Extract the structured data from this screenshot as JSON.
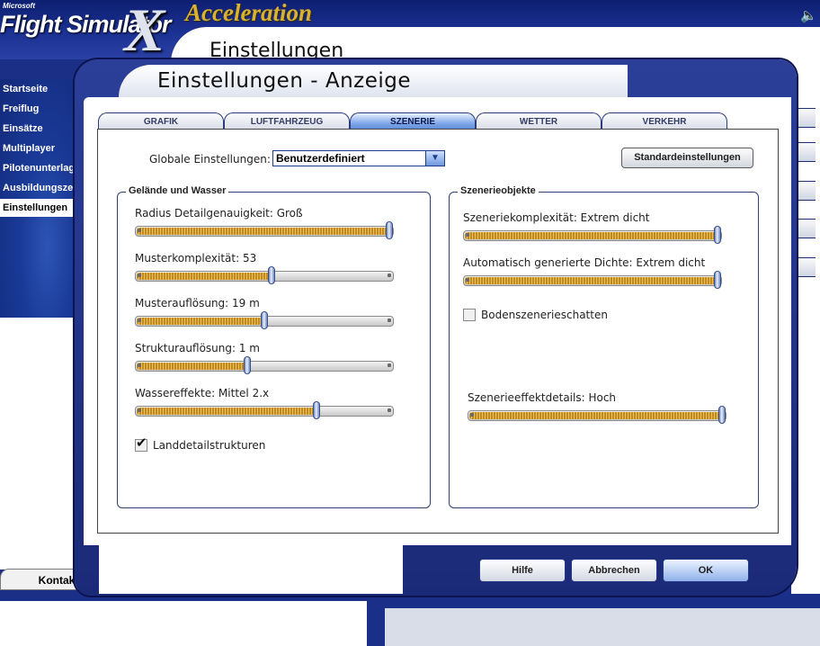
{
  "app": {
    "logo_microsoft": "Microsoft",
    "logo_product": "Flight Simulator",
    "logo_x": "X",
    "logo_edition": "Acceleration",
    "page_title": "Einstellungen"
  },
  "sidebar": {
    "items": [
      {
        "label": "Startseite"
      },
      {
        "label": "Freiflug"
      },
      {
        "label": "Einsätze"
      },
      {
        "label": "Multiplayer"
      },
      {
        "label": "Pilotenunterlagen"
      },
      {
        "label": "Ausbildungszentrum"
      },
      {
        "label": "Einstellungen",
        "active": true
      }
    ]
  },
  "bottom": {
    "kontakte_tab": "Kontakte"
  },
  "dialog": {
    "title": "Einstellungen - Anzeige",
    "tabs": [
      {
        "label": "GRAFIK"
      },
      {
        "label": "LUFTFAHRZEUG"
      },
      {
        "label": "SZENERIE",
        "active": true
      },
      {
        "label": "WETTER"
      },
      {
        "label": "VERKEHR"
      }
    ],
    "global_label": "Globale Einstellungen:",
    "global_value": "Benutzerdefiniert",
    "defaults_button": "Standardeinstellungen",
    "terrain": {
      "title": "Gelände und Wasser",
      "sliders": [
        {
          "label": "Radius Detailgenauigkeit: Groß",
          "value": 1.0
        },
        {
          "label": "Musterkomplexität: 53",
          "value": 0.53
        },
        {
          "label": "Musterauflösung: 19 m",
          "value": 0.5
        },
        {
          "label": "Strukturauflösung: 1 m",
          "value": 0.43
        },
        {
          "label": "Wassereffekte: Mittel 2.x",
          "value": 0.71
        }
      ],
      "checkbox_label": "Landdetailstrukturen",
      "checkbox_checked": true
    },
    "scenery": {
      "title": "Szenerieobjekte",
      "sliders": [
        {
          "label": "Szeneriekomplexität: Extrem dicht",
          "value": 1.0
        },
        {
          "label": "Automatisch generierte Dichte: Extrem dicht",
          "value": 1.0
        }
      ],
      "checkbox_label": "Bodenszenerieschatten",
      "checkbox_checked": false,
      "effects_slider": {
        "label": "Szenerieeffektdetails: Hoch",
        "value": 1.0
      }
    },
    "buttons": {
      "help": "Hilfe",
      "cancel": "Abbrechen",
      "ok": "OK"
    }
  },
  "colors": {
    "frame": "#1f2f86",
    "active_tab": "#6f98dd",
    "slider_fill": "#d6a23a"
  }
}
